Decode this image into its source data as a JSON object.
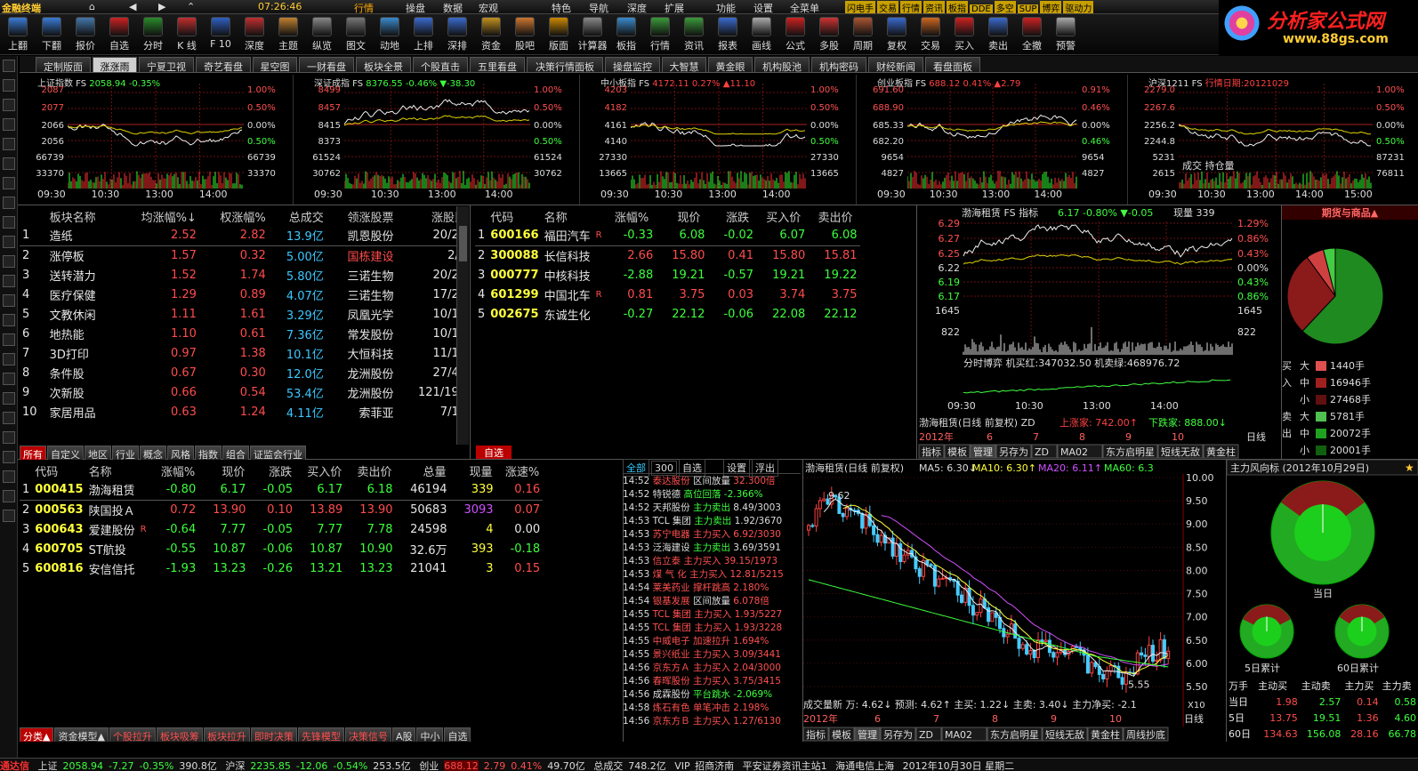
{
  "menubar": {
    "logo": "金融终端",
    "time": "07:26:46",
    "items": [
      "行情",
      "操盘",
      "数据",
      "宏观",
      "特色",
      "导航",
      "深度",
      "扩展",
      "功能",
      "设置",
      "全菜单"
    ],
    "tags": [
      "闪电手",
      "交易",
      "行情",
      "资讯",
      "板指",
      "DDE",
      "多空",
      "SUP",
      "博弈",
      "驱动力"
    ],
    "brand": "分析家公式网",
    "brand_url": "www.88gs.com"
  },
  "toolbar": [
    {
      "label": "上翻",
      "color": "#3a7bd5"
    },
    {
      "label": "下翻",
      "color": "#3a7bd5"
    },
    {
      "label": "报价",
      "color": "#4477aa"
    },
    {
      "label": "自选",
      "color": "#cc2222"
    },
    {
      "label": "分时",
      "color": "#2a8a2a"
    },
    {
      "label": "K 线",
      "color": "#c03030"
    },
    {
      "label": "F 10",
      "color": "#3060c0"
    },
    {
      "label": "深度",
      "color": "#c03030"
    },
    {
      "label": "主题",
      "color": "#c08030"
    },
    {
      "label": "纵览",
      "color": "#888888"
    },
    {
      "label": "图文",
      "color": "#777777"
    },
    {
      "label": "动地",
      "color": "#3a8acc"
    },
    {
      "label": "上排",
      "color": "#3a6acc"
    },
    {
      "label": "深排",
      "color": "#3a6acc"
    },
    {
      "label": "资金",
      "color": "#c09020"
    },
    {
      "label": "股吧",
      "color": "#cc7730"
    },
    {
      "label": "版面",
      "color": "#cc8800"
    },
    {
      "label": "计算器",
      "color": "#888888"
    },
    {
      "label": "板指",
      "color": "#3a8acc"
    },
    {
      "label": "行情",
      "color": "#3a9a3a"
    },
    {
      "label": "资讯",
      "color": "#3a9a3a"
    },
    {
      "label": "报表",
      "color": "#3a6acc"
    },
    {
      "label": "画线",
      "color": "#aaaaaa"
    },
    {
      "label": "公式",
      "color": "#cc2222"
    },
    {
      "label": "多股",
      "color": "#cc3333"
    },
    {
      "label": "周期",
      "color": "#aa5533"
    },
    {
      "label": "复权",
      "color": "#3a6acc"
    },
    {
      "label": "交易",
      "color": "#cc6622"
    },
    {
      "label": "买入",
      "color": "#cc2222"
    },
    {
      "label": "卖出",
      "color": "#3a6acc"
    },
    {
      "label": "全撤",
      "color": "#cc2222"
    },
    {
      "label": "预警",
      "color": "#aaaaaa"
    }
  ],
  "tabs": [
    "定制版面",
    "涨涨雨",
    "宁夏卫视",
    "奇艺看盘",
    "星空图",
    "一财看盘",
    "板块全景",
    "个股直击",
    "五里看盘",
    "决策行情面板",
    "操盘监控",
    "大智慧",
    "黄金眼",
    "机构股池",
    "机构密码",
    "财经新闻",
    "看盘面板"
  ],
  "tabs_active": 1,
  "index_charts": [
    {
      "name": "上证指数",
      "code": "FS",
      "value": "2058.94",
      "chg": "-0.35%",
      "chg2": "",
      "left": [
        "2087",
        "2077",
        "2066",
        "2056",
        "66739",
        "33370"
      ],
      "right": [
        "1.00%",
        "0.50%",
        "0.00%",
        "0.50%",
        "66739",
        "33370"
      ],
      "ticks": [
        "09:30",
        "10:30",
        "13:00",
        "14:00"
      ]
    },
    {
      "name": "深证成指",
      "code": "FS",
      "value": "8376.55",
      "chg": "-0.46%",
      "chg2": "▼-38.30",
      "left": [
        "8499",
        "8457",
        "8415",
        "8373",
        "61524",
        "30762"
      ],
      "right": [
        "1.00%",
        "0.50%",
        "0.00%",
        "0.50%",
        "61524",
        "30762"
      ],
      "ticks": [
        "09:30",
        "10:30",
        "13:00",
        "14:00"
      ]
    },
    {
      "name": "中小板指",
      "code": "FS",
      "value": "4172.11",
      "chg": "0.27%",
      "chg2": "▲11.10",
      "left": [
        "4203",
        "4182",
        "4161",
        "4140",
        "27330",
        "13665"
      ],
      "right": [
        "1.00%",
        "0.50%",
        "0.00%",
        "0.50%",
        "27330",
        "13665"
      ],
      "ticks": [
        "09:30",
        "10:30",
        "13:00",
        "14:00"
      ]
    },
    {
      "name": "创业板指",
      "code": "FS",
      "value": "688.12",
      "chg": "0.41%",
      "chg2": "▲2.79",
      "left": [
        "691.60",
        "688.90",
        "685.33",
        "682.20",
        "9654",
        "4827"
      ],
      "right": [
        "0.91%",
        "0.46%",
        "0.00%",
        "0.46%",
        "9654",
        "4827"
      ],
      "ticks": [
        "09:30",
        "10:30",
        "13:00",
        "14:00"
      ]
    },
    {
      "name": "沪深1211",
      "code": "FS",
      "value": "行情日期:20121029",
      "chg": "",
      "chg2": "",
      "left": [
        "2279.0",
        "2267.6",
        "2256.2",
        "2244.8",
        "5231",
        "2615"
      ],
      "right": [
        "1.00%",
        "0.50%",
        "0.00%",
        "0.50%",
        "87231",
        "76811"
      ],
      "ticks": [
        "09:30",
        "10:30",
        "13:00",
        "14:00",
        "15:00"
      ],
      "extra": "成交 持仓量"
    }
  ],
  "sector_table": {
    "headers": [
      "板块名称",
      "均涨幅%↓",
      "权涨幅%",
      "总成交",
      "领涨股票",
      "涨股比"
    ],
    "rows": [
      [
        "1",
        "造纸",
        "2.52",
        "2.82",
        "13.9亿",
        "凯恩股份",
        "20/24"
      ],
      [
        "2",
        "涨停板",
        "1.57",
        "0.32",
        "5.00亿",
        "国栋建设",
        "2/6"
      ],
      [
        "3",
        "送转潜力",
        "1.52",
        "1.74",
        "5.80亿",
        "三诺生物",
        "20/22"
      ],
      [
        "4",
        "医疗保健",
        "1.29",
        "0.89",
        "4.07亿",
        "三诺生物",
        "17/22"
      ],
      [
        "5",
        "文教休闲",
        "1.11",
        "1.61",
        "3.29亿",
        "凤凰光学",
        "10/16"
      ],
      [
        "6",
        "地热能",
        "1.10",
        "0.61",
        "7.36亿",
        "常发股份",
        "10/13"
      ],
      [
        "7",
        "3D打印",
        "0.97",
        "1.38",
        "10.1亿",
        "大恒科技",
        "11/18"
      ],
      [
        "8",
        "条件股",
        "0.67",
        "0.30",
        "12.0亿",
        "龙洲股份",
        "27/41"
      ],
      [
        "9",
        "次新股",
        "0.66",
        "0.54",
        "53.4亿",
        "龙洲股份",
        "121/192"
      ],
      [
        "10",
        "家居用品",
        "0.63",
        "1.24",
        "4.11亿",
        "索菲亚",
        "7/14"
      ]
    ]
  },
  "stock_table_top": {
    "headers": [
      "代码",
      "名称",
      "涨幅%",
      "现价",
      "涨跌",
      "买入价",
      "卖出价"
    ],
    "rows": [
      [
        "1",
        "600166",
        "福田汽车",
        "R",
        "-0.33",
        "6.08",
        "-0.02",
        "6.07",
        "6.08"
      ],
      [
        "2",
        "300088",
        "长信科技",
        "",
        "2.66",
        "15.80",
        "0.41",
        "15.80",
        "15.81"
      ],
      [
        "3",
        "000777",
        "中核科技",
        "",
        "-2.88",
        "19.21",
        "-0.57",
        "19.21",
        "19.22"
      ],
      [
        "4",
        "601299",
        "中国北车",
        "R",
        "0.81",
        "3.75",
        "0.03",
        "3.74",
        "3.75"
      ],
      [
        "5",
        "002675",
        "东诚生化",
        "",
        "-0.27",
        "22.12",
        "-0.06",
        "22.08",
        "22.12"
      ]
    ]
  },
  "intraday": {
    "title": "渤海租赁",
    "fs": "FS 指标",
    "value": "6.17",
    "chg": "-0.80%",
    "chg2": "▼-0.05",
    "vol": "现量 339",
    "left": [
      "6.29",
      "6.27",
      "6.25",
      "6.22",
      "6.19",
      "6.17",
      "1645",
      "822"
    ],
    "right": [
      "1.29%",
      "0.86%",
      "0.43%",
      "0.00%",
      "0.43%",
      "0.86%",
      "1645",
      "822"
    ],
    "info": "分时博弈  机买红:347032.50  机卖绿:468976.72",
    "ticks": [
      "09:30",
      "10:30",
      "13:00",
      "14:00"
    ],
    "daily": "渤海租赁(日线 前复权) ZD",
    "up": "上涨家: 742.00↑",
    "down": "下跌家: 888.00↓",
    "year": "2012年",
    "months": [
      "6",
      "7",
      "8",
      "9",
      "10"
    ],
    "period": "日线",
    "subtabs": [
      "指标",
      "模板",
      "管理",
      "另存为",
      "ZD",
      "MA02",
      "东方启明星",
      "短线无敌",
      "黄金柱"
    ]
  },
  "futures": {
    "title": "期货与商品▲",
    "pie": [
      62,
      28,
      6,
      4
    ],
    "pie_colors": [
      "#1f8a1f",
      "#8b1a1a",
      "#d04040",
      "#44cc44"
    ]
  },
  "flow": {
    "side_labels": [
      "买",
      "入",
      "卖",
      "出"
    ],
    "rows": [
      {
        "size": "大",
        "val": "1440手",
        "color": "#e05050"
      },
      {
        "size": "中",
        "val": "16946手",
        "color": "#a02020"
      },
      {
        "size": "小",
        "val": "27468手",
        "color": "#601010"
      },
      {
        "size": "大",
        "val": "5781手",
        "color": "#50c050"
      },
      {
        "size": "中",
        "val": "20072手",
        "color": "#20a020"
      },
      {
        "size": "小",
        "val": "20001手",
        "color": "#106010"
      }
    ]
  },
  "bottom_tabs": [
    "所有",
    "自定义",
    "地区",
    "行业",
    "概念",
    "风格",
    "指数",
    "组合",
    "证监会行业"
  ],
  "zixuan": "自选",
  "stock_table_bottom": {
    "headers": [
      "代码",
      "名称",
      "涨幅%",
      "现价",
      "涨跌",
      "买入价",
      "卖出价",
      "总量",
      "现量",
      "涨速%"
    ],
    "rows": [
      [
        "1",
        "000415",
        "渤海租赁",
        "",
        "-0.80",
        "6.17",
        "-0.05",
        "6.17",
        "6.18",
        "46194",
        "339",
        "0.16"
      ],
      [
        "2",
        "000563",
        "陕国投Ａ",
        "",
        "0.72",
        "13.90",
        "0.10",
        "13.89",
        "13.90",
        "50683",
        "3093",
        "0.07"
      ],
      [
        "3",
        "600643",
        "爱建股份",
        "R",
        "-0.64",
        "7.77",
        "-0.05",
        "7.77",
        "7.78",
        "24598",
        "4",
        "0.00"
      ],
      [
        "4",
        "600705",
        "ST航投",
        "",
        "-0.55",
        "10.87",
        "-0.06",
        "10.87",
        "10.90",
        "32.6万",
        "393",
        "-0.18"
      ],
      [
        "5",
        "600816",
        "安信信托",
        "",
        "-1.93",
        "13.23",
        "-0.26",
        "13.21",
        "13.23",
        "21041",
        "3",
        "0.15"
      ]
    ]
  },
  "ticker": {
    "tabs": [
      "全部",
      "300",
      "自选",
      "设置",
      "浮出"
    ],
    "rows": [
      [
        "14:52",
        "泰达股份",
        "区间放量",
        "32.300倍"
      ],
      [
        "14:52",
        "特锐德",
        "高位回落",
        "-2.366%"
      ],
      [
        "14:52",
        "天邦股份",
        "主力卖出",
        "8.49/3003"
      ],
      [
        "14:53",
        "TCL 集团",
        "主力卖出",
        "1.92/3670"
      ],
      [
        "14:53",
        "苏宁电器",
        "主力买入",
        "6.92/3030"
      ],
      [
        "14:53",
        "泛海建设",
        "主力卖出",
        "3.69/3591"
      ],
      [
        "14:53",
        "信立泰",
        "主力买入",
        "39.15/1973"
      ],
      [
        "14:53",
        "煤 气 化",
        "主力买入",
        "12.81/5215"
      ],
      [
        "14:54",
        "莱美药业",
        "撑杆跳高",
        "2.180%"
      ],
      [
        "14:54",
        "银基发展",
        "区间放量",
        "6.078倍"
      ],
      [
        "14:55",
        "TCL 集团",
        "主力买入",
        "1.93/5227"
      ],
      [
        "14:55",
        "TCL 集团",
        "主力买入",
        "1.93/3228"
      ],
      [
        "14:55",
        "中威电子",
        "加速拉升",
        "1.694%"
      ],
      [
        "14:55",
        "景兴纸业",
        "主力买入",
        "3.09/3441"
      ],
      [
        "14:56",
        "京东方Ａ",
        "主力买入",
        "2.04/3000"
      ],
      [
        "14:56",
        "春晖股份",
        "主力买入",
        "3.75/3415"
      ],
      [
        "14:56",
        "成霖股份",
        "平台跳水",
        "-2.069%"
      ],
      [
        "14:58",
        "炼石有色",
        "单笔冲击",
        "2.198%"
      ],
      [
        "14:56",
        "京东方Ｂ",
        "主力买入",
        "1.27/6130"
      ]
    ]
  },
  "kline": {
    "title": "渤海租赁(日线 前复权)",
    "ma5": "MA5: 6.30↓",
    "ma10": "MA10: 6.30↑",
    "ma20": "MA20: 6.11↑",
    "ma60": "MA60: 6.3",
    "high": "9.62",
    "low": "5.55",
    "axis": [
      "10.00",
      "9.50",
      "9.00",
      "8.50",
      "8.00",
      "7.50",
      "7.00",
      "6.50",
      "6.00",
      "5.50"
    ],
    "vol": "成交量新 万: 4.62↓ 预测: 4.62↑ 主买: 1.22↓ 主卖: 3.40↓ 主力净买: -2.1",
    "x10": "X10",
    "year": "2012年",
    "months": [
      "6",
      "7",
      "8",
      "9",
      "10"
    ],
    "period": "日线",
    "subtabs": [
      "指标",
      "模板",
      "管理",
      "另存为",
      "ZD",
      "MA02",
      "东方启明星",
      "短线无敌",
      "黄金柱",
      "周线抄底"
    ]
  },
  "mainforce": {
    "title": "主力风向标 (2012年10月29日)",
    "labels": [
      "当日",
      "5日累计",
      "60日累计"
    ],
    "table_headers": [
      "万手",
      "主动买",
      "主动卖",
      "主力买",
      "主力卖"
    ],
    "table_rows": [
      [
        "当日",
        "1.98",
        "2.57",
        "0.14",
        "0.58"
      ],
      [
        "5日",
        "13.75",
        "19.51",
        "1.36",
        "4.60"
      ],
      [
        "60日",
        "134.63",
        "156.08",
        "28.16",
        "66.78"
      ]
    ]
  },
  "bottom_nav": [
    "分类▲",
    "资金模型▲",
    "个股拉升",
    "板块吸筹",
    "板块拉升",
    "即时决策",
    "先锋模型",
    "决策信号",
    "A股",
    "中小",
    "自选"
  ],
  "statusbar": {
    "brand": "通达信",
    "sh": "上证",
    "sh_val": "2058.94",
    "sh_chg": "-7.27",
    "sh_pct": "-0.35%",
    "sh_amt": "390.8亿",
    "sz": "沪深",
    "sz_val": "2235.85",
    "sz_chg": "-12.06",
    "sz_pct": "-0.54%",
    "sz_amt": "253.5亿",
    "cy": "创业",
    "cy_val": "688.12",
    "cy_chg": "2.79",
    "cy_pct": "0.41%",
    "cy_amt": "49.70亿",
    "total": "总成交",
    "total_val": "748.2亿",
    "vip": "VIP_招商济南",
    "broker": "平安证券资讯主站1",
    "server": "海通电信上海",
    "date": "2012年10月30日 星期二"
  }
}
